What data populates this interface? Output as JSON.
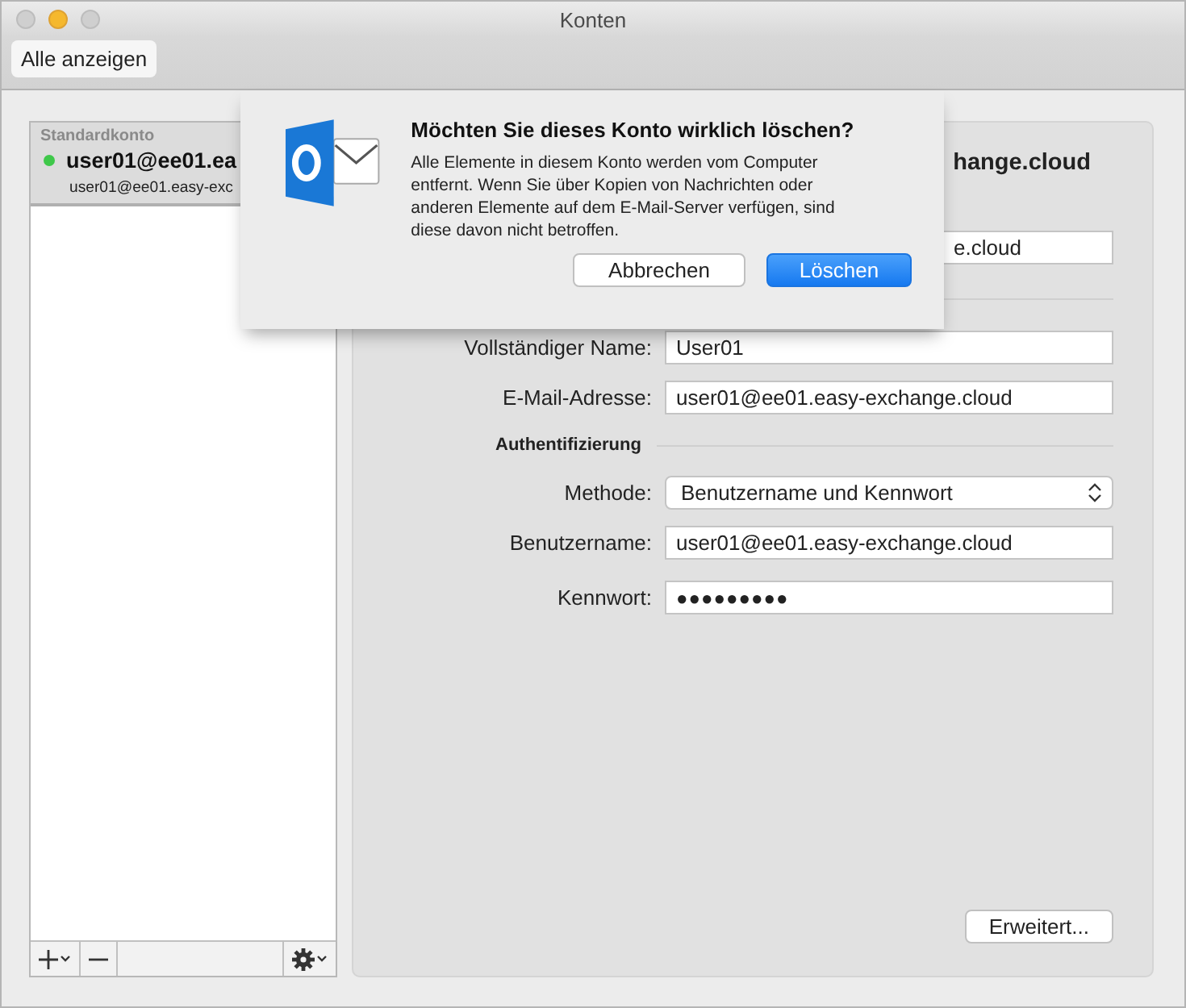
{
  "window": {
    "title": "Konten"
  },
  "toolbar": {
    "show_all": "Alle anzeigen"
  },
  "sidebar": {
    "section": "Standardkonto",
    "accounts": [
      {
        "name": "user01@ee01.ea",
        "address": "user01@ee01.easy-exc",
        "selected": true,
        "color": "#3fc84a"
      }
    ]
  },
  "details": {
    "header": "hange.cloud",
    "top_field": "e.cloud",
    "rows": [
      {
        "kind": "field",
        "label": "Vollständiger Name:",
        "value": "User01"
      },
      {
        "kind": "field",
        "label": "E-Mail-Adresse:",
        "value": "user01@ee01.easy-exchange.cloud"
      },
      {
        "kind": "heading",
        "label": "Authentifizierung"
      },
      {
        "kind": "select",
        "label": "Methode:",
        "value": "Benutzername und Kennwort"
      },
      {
        "kind": "field",
        "label": "Benutzername:",
        "value": "user01@ee01.easy-exchange.cloud"
      },
      {
        "kind": "password",
        "label": "Kennwort:",
        "value": "●●●●●●●●●"
      }
    ],
    "advanced_button": "Erweitert..."
  },
  "dialog": {
    "title": "Möchten Sie dieses Konto wirklich löschen?",
    "message": "Alle Elemente in diesem Konto werden vom Computer entfernt. Wenn Sie über Kopien von Nachrichten oder anderen Elemente auf dem E-Mail-Server verfügen, sind diese davon nicht betroffen.",
    "buttons": [
      {
        "label": "Abbrechen",
        "default": false
      },
      {
        "label": "Löschen",
        "default": true
      }
    ]
  }
}
